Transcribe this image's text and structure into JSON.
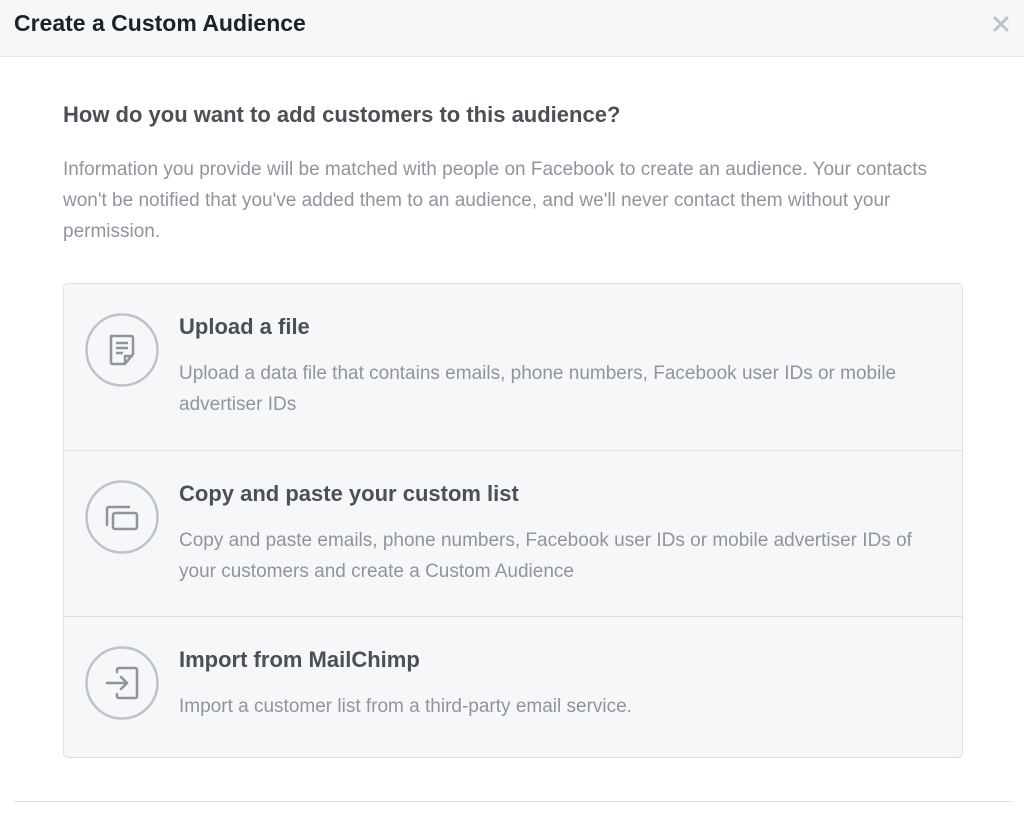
{
  "dialog": {
    "title": "Create a Custom Audience",
    "close_icon": "close-icon"
  },
  "main": {
    "question": "How do you want to add customers to this audience?",
    "info": "Information you provide will be matched with people on Facebook to create an audience. Your contacts won't be notified that you've added them to an audience, and we'll never contact them without your permission."
  },
  "options": [
    {
      "icon": "document-icon",
      "title": "Upload a file",
      "description": "Upload a data file that contains emails, phone numbers, Facebook user IDs or mobile advertiser IDs"
    },
    {
      "icon": "copy-paste-icon",
      "title": "Copy and paste your custom list",
      "description": "Copy and paste emails, phone numbers, Facebook user IDs or mobile advertiser IDs of your customers and create a Custom Audience"
    },
    {
      "icon": "import-icon",
      "title": "Import from MailChimp",
      "description": "Import a customer list from a third-party email service."
    }
  ],
  "colors": {
    "header_bg": "#f6f7f9",
    "title_text": "#1d2129",
    "heading_text": "#4b4f56",
    "muted_text": "#90949c",
    "border": "#dddfe2",
    "icon_stroke": "#90949c"
  }
}
